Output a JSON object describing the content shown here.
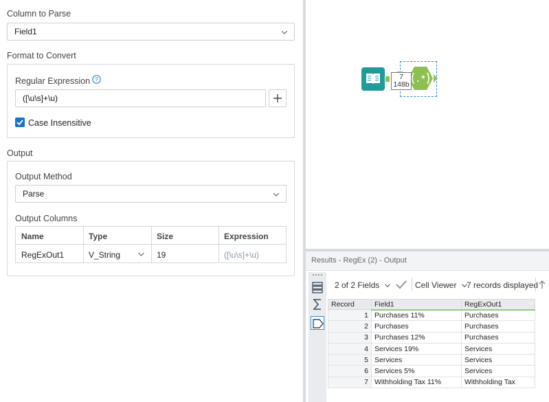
{
  "config": {
    "column_to_parse_label": "Column to Parse",
    "column_to_parse_value": "Field1",
    "format_label": "Format to Convert",
    "regex_label": "Regular Expression",
    "regex_value": "([\\u\\s]+\\u)",
    "case_insensitive_label": "Case Insensitive",
    "case_insensitive_checked": true,
    "output_label": "Output",
    "output_method_label": "Output Method",
    "output_method_value": "Parse",
    "output_columns_label": "Output Columns",
    "columns_headers": [
      "Name",
      "Type",
      "Size",
      "Expression"
    ],
    "columns_row": {
      "name": "RegExOut1",
      "type": "V_String",
      "size": "19",
      "expression": "([\\u\\s]+\\u)"
    }
  },
  "canvas": {
    "connection_count": "7",
    "connection_size": "148b",
    "input_tool_icon": "book-icon",
    "regex_tool_icon": "regex-hexagon-icon"
  },
  "results": {
    "title": "Results - RegEx (2) - Output",
    "fields_label": "2 of 2 Fields",
    "cell_viewer_label": "Cell Viewer",
    "records_label": "7 records displayed",
    "headers": [
      "Record",
      "Field1",
      "RegExOut1"
    ],
    "rows": [
      {
        "record": "1",
        "field1": "Purchases 11%",
        "out": "Purchases"
      },
      {
        "record": "2",
        "field1": "Purchases",
        "out": "Purchases"
      },
      {
        "record": "3",
        "field1": "Purchases 12%",
        "out": "Purchases"
      },
      {
        "record": "4",
        "field1": "Services 19%",
        "out": "Services"
      },
      {
        "record": "5",
        "field1": "Services",
        "out": "Services"
      },
      {
        "record": "6",
        "field1": "Services 5%",
        "out": "Services"
      },
      {
        "record": "7",
        "field1": "Withholding Tax 11%",
        "out": "Withholding Tax"
      }
    ]
  },
  "colors": {
    "accent": "#1a73c8",
    "tool_teal": "#1f9b9b",
    "tool_green": "#8cc152",
    "selection": "#2d8ad8"
  }
}
